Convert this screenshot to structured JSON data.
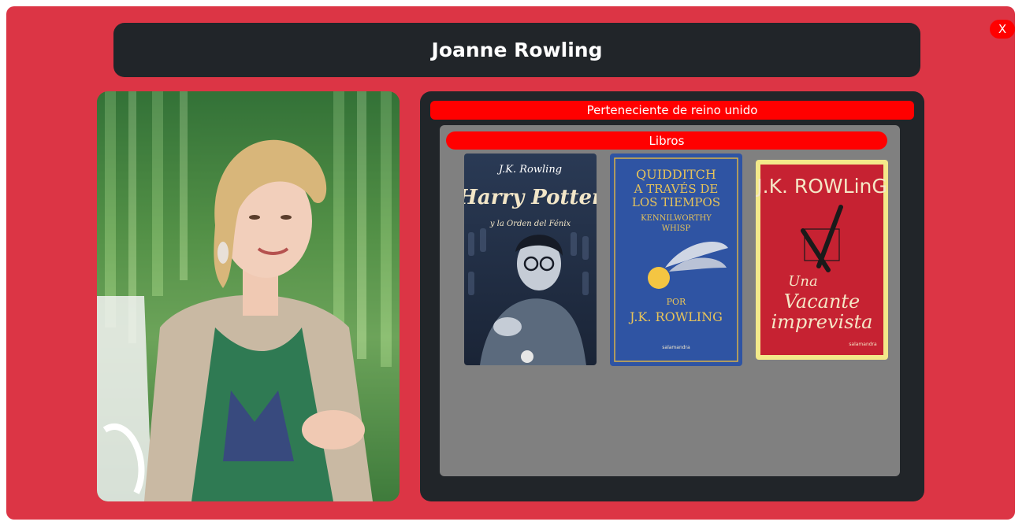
{
  "modal": {
    "close_label": "X",
    "title": "Joanne Rowling"
  },
  "info": {
    "country": "Perteneciente de reino unido",
    "books_label": "Libros"
  },
  "books": [
    {
      "author_line": "J.K. Rowling",
      "title_line_1": "Harry Potter",
      "title_line_2": "y la Orden del Fénix"
    },
    {
      "title_line_1": "QUIDDITCH",
      "title_line_2": "A TRAVÉS DE",
      "title_line_3": "LOS TIEMPOS",
      "subtitle_1": "KENNILWORTHY",
      "subtitle_2": "WHISP",
      "by_label": "POR",
      "author_line": "J.K. ROWLING",
      "publisher": "salamandra"
    },
    {
      "author_line": "J.K. ROWLinG",
      "title_line_1": "Una",
      "title_line_2": "Vacante",
      "title_line_3": "imprevista",
      "publisher": "salamandra"
    }
  ],
  "colors": {
    "modal_bg": "#dc3545",
    "dark_panel": "#212529",
    "accent_red": "#ff0000",
    "books_bg": "#808080"
  }
}
